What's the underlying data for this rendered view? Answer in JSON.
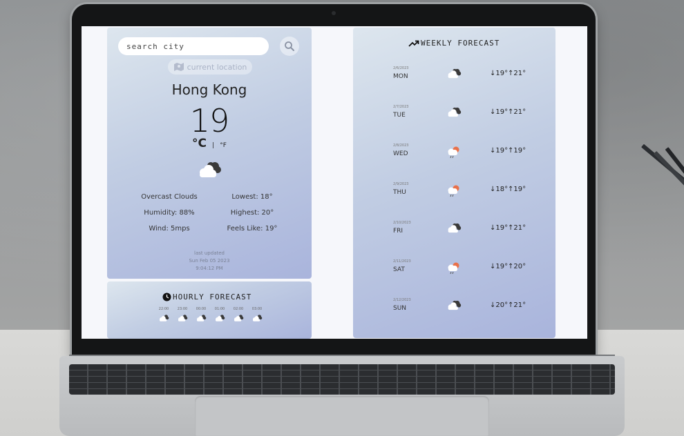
{
  "search": {
    "placeholder": "search city"
  },
  "current": {
    "location_label": "current location",
    "city": "Hong Kong",
    "temperature": "19",
    "unit_c": "°C",
    "unit_sep": "|",
    "unit_f": "°F",
    "icon": "cloudy-icon",
    "condition": "Overcast Clouds",
    "lowest": "Lowest: 18°",
    "humidity": "Humidity: 88%",
    "highest": "Highest: 20°",
    "wind": "Wind: 5mps",
    "feels_like": "Feels Like: 19°",
    "updated_label": "last updated",
    "updated_date": "Sun Feb 05 2023",
    "updated_time": "9:04:12 PM"
  },
  "hourly": {
    "title": "HOURLY FORECAST",
    "hours": [
      {
        "time": "22:00",
        "icon": "cloudy-icon"
      },
      {
        "time": "23:00",
        "icon": "cloudy-icon"
      },
      {
        "time": "00:00",
        "icon": "cloudy-icon"
      },
      {
        "time": "01:00",
        "icon": "cloudy-icon"
      },
      {
        "time": "02:00",
        "icon": "cloudy-icon"
      },
      {
        "time": "03:00",
        "icon": "cloudy-icon"
      }
    ]
  },
  "weekly": {
    "title": "WEEKLY FORECAST",
    "days": [
      {
        "date": "2/6/2023",
        "day": "MON",
        "icon": "cloudy-icon",
        "low": "↓19°",
        "high": "↑21°"
      },
      {
        "date": "2/7/2023",
        "day": "TUE",
        "icon": "cloudy-icon",
        "low": "↓19°",
        "high": "↑21°"
      },
      {
        "date": "2/8/2023",
        "day": "WED",
        "icon": "sun-rain-icon",
        "low": "↓19°",
        "high": "↑19°"
      },
      {
        "date": "2/9/2023",
        "day": "THU",
        "icon": "sun-rain-icon",
        "low": "↓18°",
        "high": "↑19°"
      },
      {
        "date": "2/10/2023",
        "day": "FRI",
        "icon": "cloudy-icon",
        "low": "↓19°",
        "high": "↑21°"
      },
      {
        "date": "2/11/2023",
        "day": "SAT",
        "icon": "sun-rain-icon",
        "low": "↓19°",
        "high": "↑20°"
      },
      {
        "date": "2/12/2023",
        "day": "SUN",
        "icon": "cloudy-icon",
        "low": "↓20°",
        "high": "↑21°"
      }
    ]
  },
  "colors": {
    "panel_top": "#dde6ee",
    "panel_bottom": "#a9b4dc",
    "screen_bg": "#f6f7fb"
  }
}
